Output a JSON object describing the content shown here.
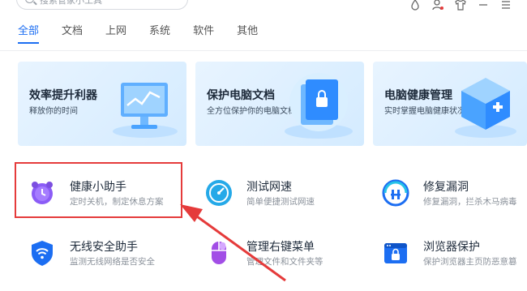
{
  "search": {
    "placeholder": "搜索管家小工具"
  },
  "toolbar": {
    "icons": [
      "skin-icon",
      "user-icon",
      "shirt-icon",
      "minimize-icon",
      "menu-icon"
    ]
  },
  "tabs": [
    {
      "label": "全部",
      "active": true
    },
    {
      "label": "文档",
      "active": false
    },
    {
      "label": "上网",
      "active": false
    },
    {
      "label": "系统",
      "active": false
    },
    {
      "label": "软件",
      "active": false
    },
    {
      "label": "其他",
      "active": false
    }
  ],
  "banners": [
    {
      "title": "效率提升利器",
      "subtitle": "释放你的时间"
    },
    {
      "title": "保护电脑文档",
      "subtitle": "全方位保护你的电脑文档"
    },
    {
      "title": "电脑健康管理",
      "subtitle": "实时掌握电脑健康状况"
    }
  ],
  "tools": [
    {
      "title": "健康小助手",
      "desc": "定时关机，制定休息方案",
      "icon": "alarm-clock-icon",
      "color": "#8b5cf6"
    },
    {
      "title": "测试网速",
      "desc": "简单便捷测试网速",
      "icon": "speedometer-icon",
      "color": "#25a9e8"
    },
    {
      "title": "修复漏洞",
      "desc": "修复漏洞，拦杀木马病毒",
      "icon": "shield-repair-icon",
      "color": "#1c6ef2"
    },
    {
      "title": "无线安全助手",
      "desc": "监测无线网络是否安全",
      "icon": "wifi-shield-icon",
      "color": "#1c6ef2"
    },
    {
      "title": "管理右键菜单",
      "desc": "管理文件和文件夹等",
      "icon": "mouse-icon",
      "color": "#a24ee6"
    },
    {
      "title": "浏览器保护",
      "desc": "保护浏览器主页防恶意篡",
      "icon": "browser-lock-icon",
      "color": "#1c6ef2"
    }
  ],
  "colors": {
    "accent": "#1c6ef2",
    "highlight": "#e53b3b"
  }
}
